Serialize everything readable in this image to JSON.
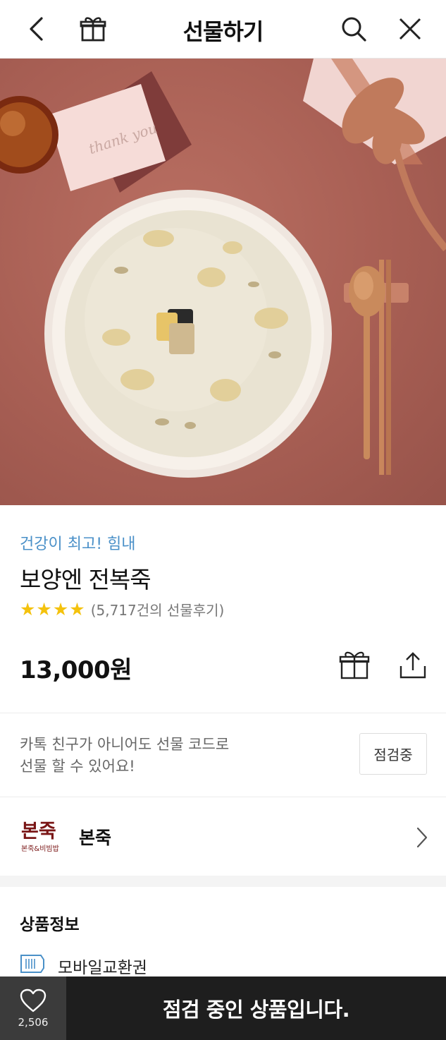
{
  "header": {
    "title": "선물하기",
    "back_icon": "chevron-left-icon",
    "gift_icon": "gift-icon",
    "search_icon": "search-icon",
    "close_icon": "close-icon"
  },
  "hero": {
    "card_text": "thank you"
  },
  "product": {
    "promo": "건강이 최고! 힘내",
    "name": "보양엔 전복죽",
    "stars": 4,
    "reviews": "(5,717건의 선물후기)",
    "price": "13,000원",
    "colors": {
      "promo": "#4a90c8",
      "star": "#f4c20d"
    }
  },
  "gift_code": {
    "line1": "카톡 친구가 아니어도 선물 코드로",
    "line2": "선물 할 수 있어요!",
    "button": "점검중"
  },
  "brand": {
    "logo_main": "본죽",
    "logo_sub": "본죽&비빔밥",
    "name": "본죽"
  },
  "info": {
    "title": "상품정보",
    "type": "모바일교환권"
  },
  "bottom": {
    "likes": "2,506",
    "status": "점검 중인 상품입니다."
  }
}
